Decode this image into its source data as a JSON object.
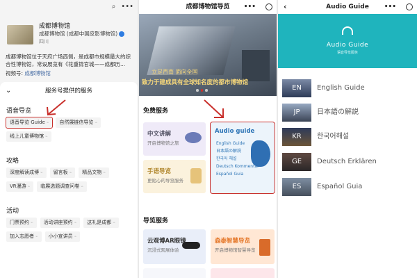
{
  "panel1": {
    "account_name": "成都博物馆",
    "account_sub": "成都博物馆 (成都中国皮影博物馆)",
    "location": "四川",
    "description": "成都博物馆位于天府广场西侧，是成都市规模最大的综合性博物馆，常设展览有《花重锦官城——成都历...",
    "video_label": "视频号:",
    "video_link": "成都博物馆",
    "sheet_title": "服务号提供的服务",
    "sections": [
      {
        "title": "语音导览",
        "items": [
          "语音导览 Guide",
          "自然展链信导览",
          "线上儿童博物馆"
        ]
      },
      {
        "title": "攻略",
        "items": [
          "深度解读成博",
          "留言板",
          "精品文物",
          "VR漫游",
          "临展选题调查问卷"
        ]
      },
      {
        "title": "活动",
        "items": [
          "门票预约",
          "活动讲座预约",
          "这礼是成都",
          "加入志愿者",
          "小小宣讲员"
        ]
      }
    ]
  },
  "panel2": {
    "title": "成都博物馆导览",
    "banner_line1": "立足西南  面向全国",
    "banner_line2": "致力于建成具有全球知名度的都市博物馆",
    "free_services": "免费服务",
    "cards": {
      "zh": {
        "title": "中文讲解",
        "sub": "开启博物馆之旅"
      },
      "sign": {
        "title": "手语导览",
        "sub": "更贴心的导览服务"
      },
      "audio": {
        "title": "Audio guide",
        "lines": [
          "English Guide",
          "日本語の解説",
          "한국어 해설",
          "Deutsch Kommentar",
          "Español Guia"
        ]
      },
      "ar": {
        "title": "云观博AR眼镜",
        "sub": "沉浸式观展体验"
      },
      "smart": {
        "title": "森泰智慧导览",
        "sub": "开启博物馆智慧导览"
      }
    },
    "guide_services": "导览服务"
  },
  "panel3": {
    "title": "Audio Guide",
    "hero_title": "Audio Guide",
    "hero_sub": "语音导览服务",
    "languages": [
      {
        "code": "EN",
        "label": "English Guide"
      },
      {
        "code": "JP",
        "label": "日本語の解説"
      },
      {
        "code": "KR",
        "label": "한국어해설"
      },
      {
        "code": "GE",
        "label": "Deutsch Erklären"
      },
      {
        "code": "ES",
        "label": "Español Guia"
      }
    ]
  },
  "colors": {
    "highlight": "#c9302c",
    "teal": "#1fb4bd",
    "link": "#2e75b6"
  }
}
